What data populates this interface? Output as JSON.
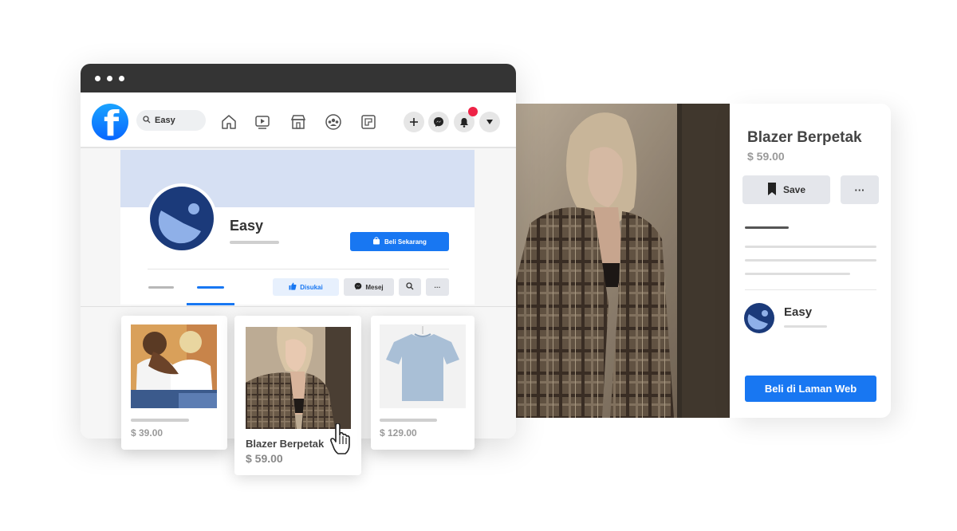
{
  "window": {
    "controls": [
      "dot",
      "dot",
      "dot"
    ]
  },
  "nav": {
    "search_value": "Easy",
    "icons": [
      "home-icon",
      "watch-icon",
      "marketplace-icon",
      "groups-icon",
      "gaming-icon"
    ],
    "right_icons": [
      "plus-icon",
      "messenger-icon",
      "bell-icon",
      "caret-down-icon"
    ]
  },
  "page": {
    "name": "Easy",
    "buy_button": "Beli Sekarang",
    "like_button": "Disukai",
    "message_button": "Mesej",
    "more_label": "···"
  },
  "products": [
    {
      "price": "$ 39.00"
    },
    {
      "title": "Blazer Berpetak",
      "price": "$ 59.00"
    },
    {
      "price": "$ 129.00"
    }
  ],
  "detail": {
    "title": "Blazer Berpetak",
    "price": "$ 59.00",
    "save_label": "Save",
    "more_label": "···",
    "seller_name": "Easy",
    "cta": "Beli di Laman Web"
  },
  "colors": {
    "accent": "#1877f2",
    "titlebar": "#343434",
    "cover": "#d6e0f3",
    "avatar": "#1b3a7a",
    "notification": "#ee2347"
  }
}
